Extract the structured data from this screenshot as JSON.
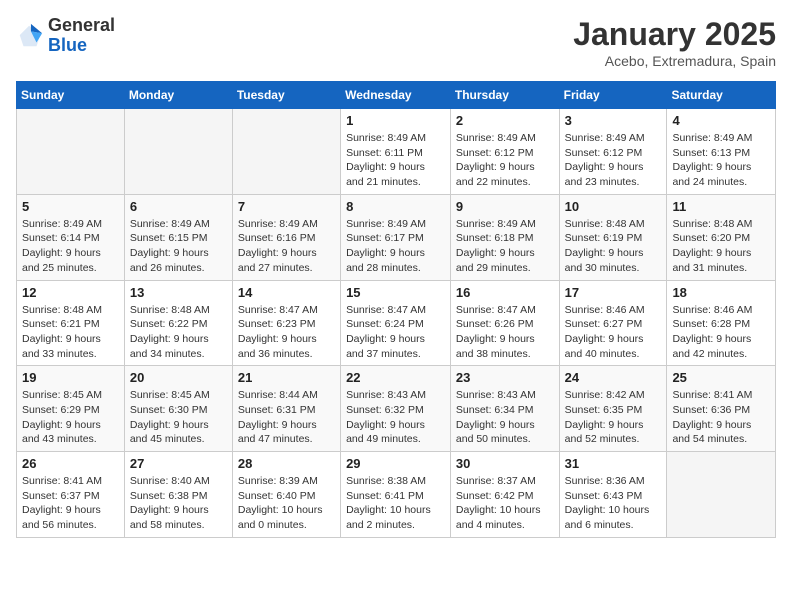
{
  "logo": {
    "general": "General",
    "blue": "Blue"
  },
  "header": {
    "title": "January 2025",
    "subtitle": "Acebo, Extremadura, Spain"
  },
  "weekdays": [
    "Sunday",
    "Monday",
    "Tuesday",
    "Wednesday",
    "Thursday",
    "Friday",
    "Saturday"
  ],
  "weeks": [
    [
      {
        "day": "",
        "info": ""
      },
      {
        "day": "",
        "info": ""
      },
      {
        "day": "",
        "info": ""
      },
      {
        "day": "1",
        "info": "Sunrise: 8:49 AM\nSunset: 6:11 PM\nDaylight: 9 hours\nand 21 minutes."
      },
      {
        "day": "2",
        "info": "Sunrise: 8:49 AM\nSunset: 6:12 PM\nDaylight: 9 hours\nand 22 minutes."
      },
      {
        "day": "3",
        "info": "Sunrise: 8:49 AM\nSunset: 6:12 PM\nDaylight: 9 hours\nand 23 minutes."
      },
      {
        "day": "4",
        "info": "Sunrise: 8:49 AM\nSunset: 6:13 PM\nDaylight: 9 hours\nand 24 minutes."
      }
    ],
    [
      {
        "day": "5",
        "info": "Sunrise: 8:49 AM\nSunset: 6:14 PM\nDaylight: 9 hours\nand 25 minutes."
      },
      {
        "day": "6",
        "info": "Sunrise: 8:49 AM\nSunset: 6:15 PM\nDaylight: 9 hours\nand 26 minutes."
      },
      {
        "day": "7",
        "info": "Sunrise: 8:49 AM\nSunset: 6:16 PM\nDaylight: 9 hours\nand 27 minutes."
      },
      {
        "day": "8",
        "info": "Sunrise: 8:49 AM\nSunset: 6:17 PM\nDaylight: 9 hours\nand 28 minutes."
      },
      {
        "day": "9",
        "info": "Sunrise: 8:49 AM\nSunset: 6:18 PM\nDaylight: 9 hours\nand 29 minutes."
      },
      {
        "day": "10",
        "info": "Sunrise: 8:48 AM\nSunset: 6:19 PM\nDaylight: 9 hours\nand 30 minutes."
      },
      {
        "day": "11",
        "info": "Sunrise: 8:48 AM\nSunset: 6:20 PM\nDaylight: 9 hours\nand 31 minutes."
      }
    ],
    [
      {
        "day": "12",
        "info": "Sunrise: 8:48 AM\nSunset: 6:21 PM\nDaylight: 9 hours\nand 33 minutes."
      },
      {
        "day": "13",
        "info": "Sunrise: 8:48 AM\nSunset: 6:22 PM\nDaylight: 9 hours\nand 34 minutes."
      },
      {
        "day": "14",
        "info": "Sunrise: 8:47 AM\nSunset: 6:23 PM\nDaylight: 9 hours\nand 36 minutes."
      },
      {
        "day": "15",
        "info": "Sunrise: 8:47 AM\nSunset: 6:24 PM\nDaylight: 9 hours\nand 37 minutes."
      },
      {
        "day": "16",
        "info": "Sunrise: 8:47 AM\nSunset: 6:26 PM\nDaylight: 9 hours\nand 38 minutes."
      },
      {
        "day": "17",
        "info": "Sunrise: 8:46 AM\nSunset: 6:27 PM\nDaylight: 9 hours\nand 40 minutes."
      },
      {
        "day": "18",
        "info": "Sunrise: 8:46 AM\nSunset: 6:28 PM\nDaylight: 9 hours\nand 42 minutes."
      }
    ],
    [
      {
        "day": "19",
        "info": "Sunrise: 8:45 AM\nSunset: 6:29 PM\nDaylight: 9 hours\nand 43 minutes."
      },
      {
        "day": "20",
        "info": "Sunrise: 8:45 AM\nSunset: 6:30 PM\nDaylight: 9 hours\nand 45 minutes."
      },
      {
        "day": "21",
        "info": "Sunrise: 8:44 AM\nSunset: 6:31 PM\nDaylight: 9 hours\nand 47 minutes."
      },
      {
        "day": "22",
        "info": "Sunrise: 8:43 AM\nSunset: 6:32 PM\nDaylight: 9 hours\nand 49 minutes."
      },
      {
        "day": "23",
        "info": "Sunrise: 8:43 AM\nSunset: 6:34 PM\nDaylight: 9 hours\nand 50 minutes."
      },
      {
        "day": "24",
        "info": "Sunrise: 8:42 AM\nSunset: 6:35 PM\nDaylight: 9 hours\nand 52 minutes."
      },
      {
        "day": "25",
        "info": "Sunrise: 8:41 AM\nSunset: 6:36 PM\nDaylight: 9 hours\nand 54 minutes."
      }
    ],
    [
      {
        "day": "26",
        "info": "Sunrise: 8:41 AM\nSunset: 6:37 PM\nDaylight: 9 hours\nand 56 minutes."
      },
      {
        "day": "27",
        "info": "Sunrise: 8:40 AM\nSunset: 6:38 PM\nDaylight: 9 hours\nand 58 minutes."
      },
      {
        "day": "28",
        "info": "Sunrise: 8:39 AM\nSunset: 6:40 PM\nDaylight: 10 hours\nand 0 minutes."
      },
      {
        "day": "29",
        "info": "Sunrise: 8:38 AM\nSunset: 6:41 PM\nDaylight: 10 hours\nand 2 minutes."
      },
      {
        "day": "30",
        "info": "Sunrise: 8:37 AM\nSunset: 6:42 PM\nDaylight: 10 hours\nand 4 minutes."
      },
      {
        "day": "31",
        "info": "Sunrise: 8:36 AM\nSunset: 6:43 PM\nDaylight: 10 hours\nand 6 minutes."
      },
      {
        "day": "",
        "info": ""
      }
    ]
  ]
}
